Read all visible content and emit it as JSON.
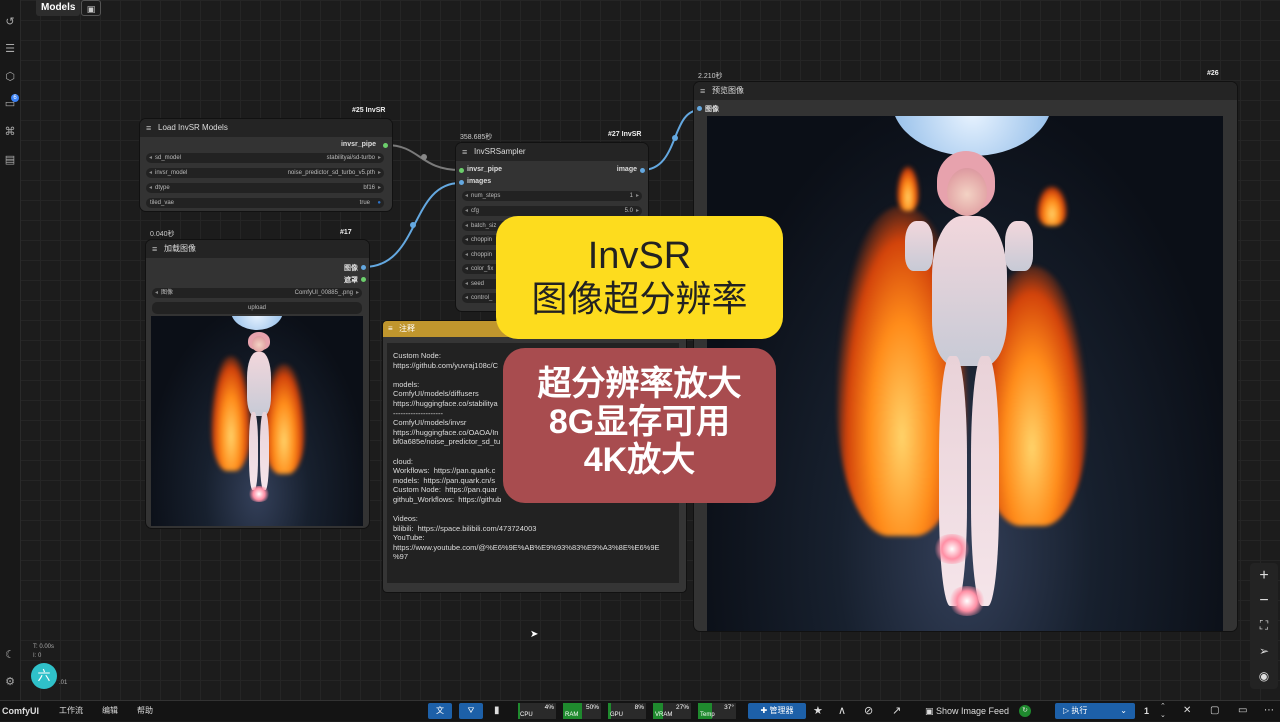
{
  "app": {
    "name": "ComfyUI",
    "menu": [
      "工作流",
      "编辑",
      "帮助"
    ]
  },
  "top": {
    "models_tab": "Models"
  },
  "nodes": {
    "load_invsr": {
      "title": "Load InvSR Models",
      "id": "#25 InvSR",
      "output": "invsr_pipe",
      "widgets": [
        {
          "label": "sd_model",
          "value": "stabilityai/sd-turbo"
        },
        {
          "label": "invsr_model",
          "value": "noise_predictor_sd_turbo_v5.pth"
        },
        {
          "label": "dtype",
          "value": "bf16"
        },
        {
          "label": "tiled_vae",
          "value": "true"
        }
      ]
    },
    "load_image": {
      "time": "0.040秒",
      "id": "#17",
      "title": "加载图像",
      "outputs": [
        "图像",
        "遮罩"
      ],
      "file_label": "图像",
      "file_value": "ComfyUI_00885_.png",
      "upload": "upload"
    },
    "sampler": {
      "time": "358.685秒",
      "id": "#27 InvSR",
      "title": "InvSRSampler",
      "inputs": [
        "invsr_pipe",
        "images"
      ],
      "output": "image",
      "widgets": [
        {
          "label": "num_steps",
          "value": "1"
        },
        {
          "label": "cfg",
          "value": "5.0"
        },
        {
          "label": "batch_siz",
          "value": ""
        },
        {
          "label": "choppin",
          "value": ""
        },
        {
          "label": "choppin",
          "value": ""
        },
        {
          "label": "color_fix",
          "value": ""
        },
        {
          "label": "seed",
          "value": ""
        },
        {
          "label": "control_",
          "value": ""
        }
      ]
    },
    "preview": {
      "time": "2.210秒",
      "id": "#26",
      "title": "预览图像",
      "input": "图像"
    },
    "note": {
      "title": "注释",
      "text": "Custom Node:\nhttps://github.com/yuvraj108c/C\n\nmodels:\nComfyUI/models/diffusers\nhttps://huggingface.co/stabilitya\n--------------------\nComfyUI/models/invsr\nhttps://huggingface.co/OAOA/In\nbf0a685e/noise_predictor_sd_tu\n\ncloud:\nWorkflows:  https://pan.quark.c\nmodels:  https://pan.quark.cn/s\nCustom Node:  https://pan.quar\ngithub_Workflows:  https://github\n\nVideos:\nbilibili:  https://space.bilibili.com/473724003\nYouTube:\nhttps://www.youtube.com/@%E6%9E%AB%E9%93%83%E9%A3%8E%E6%9E\n%97"
    }
  },
  "overlay": {
    "yellow_line1": "InvSR",
    "yellow_line2": "图像超分辨率",
    "red_line1": "超分辨率放大",
    "red_line2": "8G显存可用",
    "red_line3": "4K放大"
  },
  "status": {
    "t": "T: 0.00s",
    "i": "I: 0",
    "n": ".01",
    "avatar": "六"
  },
  "bottom": {
    "cpu": {
      "label": "CPU",
      "value": "4%",
      "fraction": 0.04
    },
    "ram": {
      "label": "RAM",
      "value": "50%",
      "fraction": 0.5
    },
    "gpu": {
      "label": "GPU",
      "value": "8%",
      "fraction": 0.08
    },
    "vram": {
      "label": "VRAM",
      "value": "27%",
      "fraction": 0.27
    },
    "temp": {
      "label": "Temp",
      "value": "37°",
      "fraction": 0.37
    },
    "manager": "管理器",
    "feed": "Show Image Feed",
    "run": "执行",
    "count": "1"
  }
}
